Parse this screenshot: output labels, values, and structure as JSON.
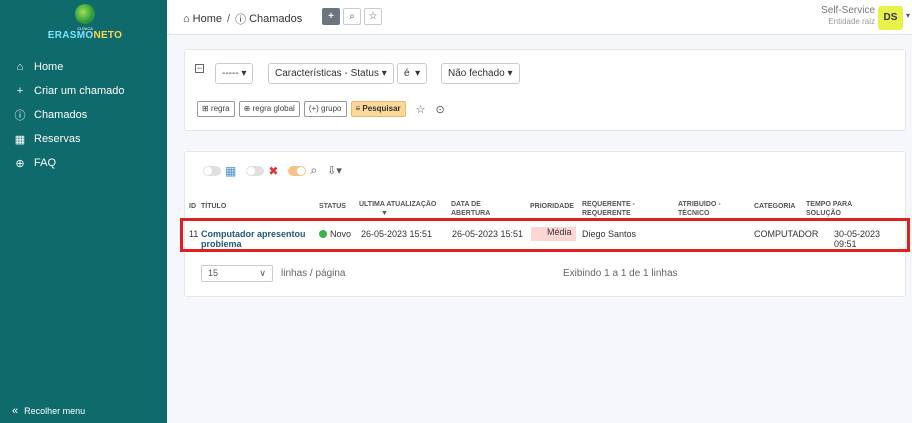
{
  "sidebar": {
    "logo": {
      "small_text": "CLÍNICA",
      "brand_a": "ERASMO",
      "brand_b": "NETO"
    },
    "items": [
      {
        "icon": "home-icon",
        "label": "Home"
      },
      {
        "icon": "plus-icon",
        "label": "Criar um chamado"
      },
      {
        "icon": "alert-circle-icon",
        "label": "Chamados"
      },
      {
        "icon": "calendar-icon",
        "label": "Reservas"
      },
      {
        "icon": "help-circle-icon",
        "label": "FAQ"
      }
    ],
    "collapse_label": "Recolher menu"
  },
  "header": {
    "breadcrumb": [
      "Home",
      "Chamados"
    ],
    "profile": "Self-Service",
    "entity": "Entidade raiz",
    "avatar_initials": "DS"
  },
  "criteria": {
    "field_selector": "-----",
    "field": "Características - Status",
    "operator": "é",
    "value": "Não fechado",
    "buttons": {
      "rule": "regra",
      "global_rule": "regra global",
      "group": "grupo",
      "search": "Pesquisar"
    }
  },
  "table": {
    "headers": {
      "id": "ID",
      "title": "TÍTULO",
      "status": "STATUS",
      "last_update": "ÚLTIMA ATUALIZAÇÃO",
      "opening_date": "DATA DE ABERTURA",
      "priority": "PRIORIDADE",
      "requester": "REQUERENTE - REQUERENTE",
      "assigned": "ATRIBUÍDO - TÉCNICO",
      "category": "CATEGORIA",
      "solve_time": "TEMPO PARA SOLUÇÃO"
    },
    "rows": [
      {
        "id": "11",
        "title": "Computador apresentou problema",
        "status": "Novo",
        "last_update": "26-05-2023 15:51",
        "opening_date": "26-05-2023 15:51",
        "priority": "Média",
        "requester": "Diego Santos",
        "assigned": "",
        "category": "COMPUTADOR",
        "solve_time": "30-05-2023 09:51"
      }
    ],
    "status_color": "#3cb34a",
    "priority_color": "#ffd6d6"
  },
  "pagination": {
    "page_size": "15",
    "page_size_label": "linhas / página",
    "showing": "Exibindo 1 a 1 de 1 linhas"
  },
  "colors": {
    "sidebar": "#0f6b6b",
    "accent": "#fbd79a",
    "highlight": "#e01e1e"
  }
}
